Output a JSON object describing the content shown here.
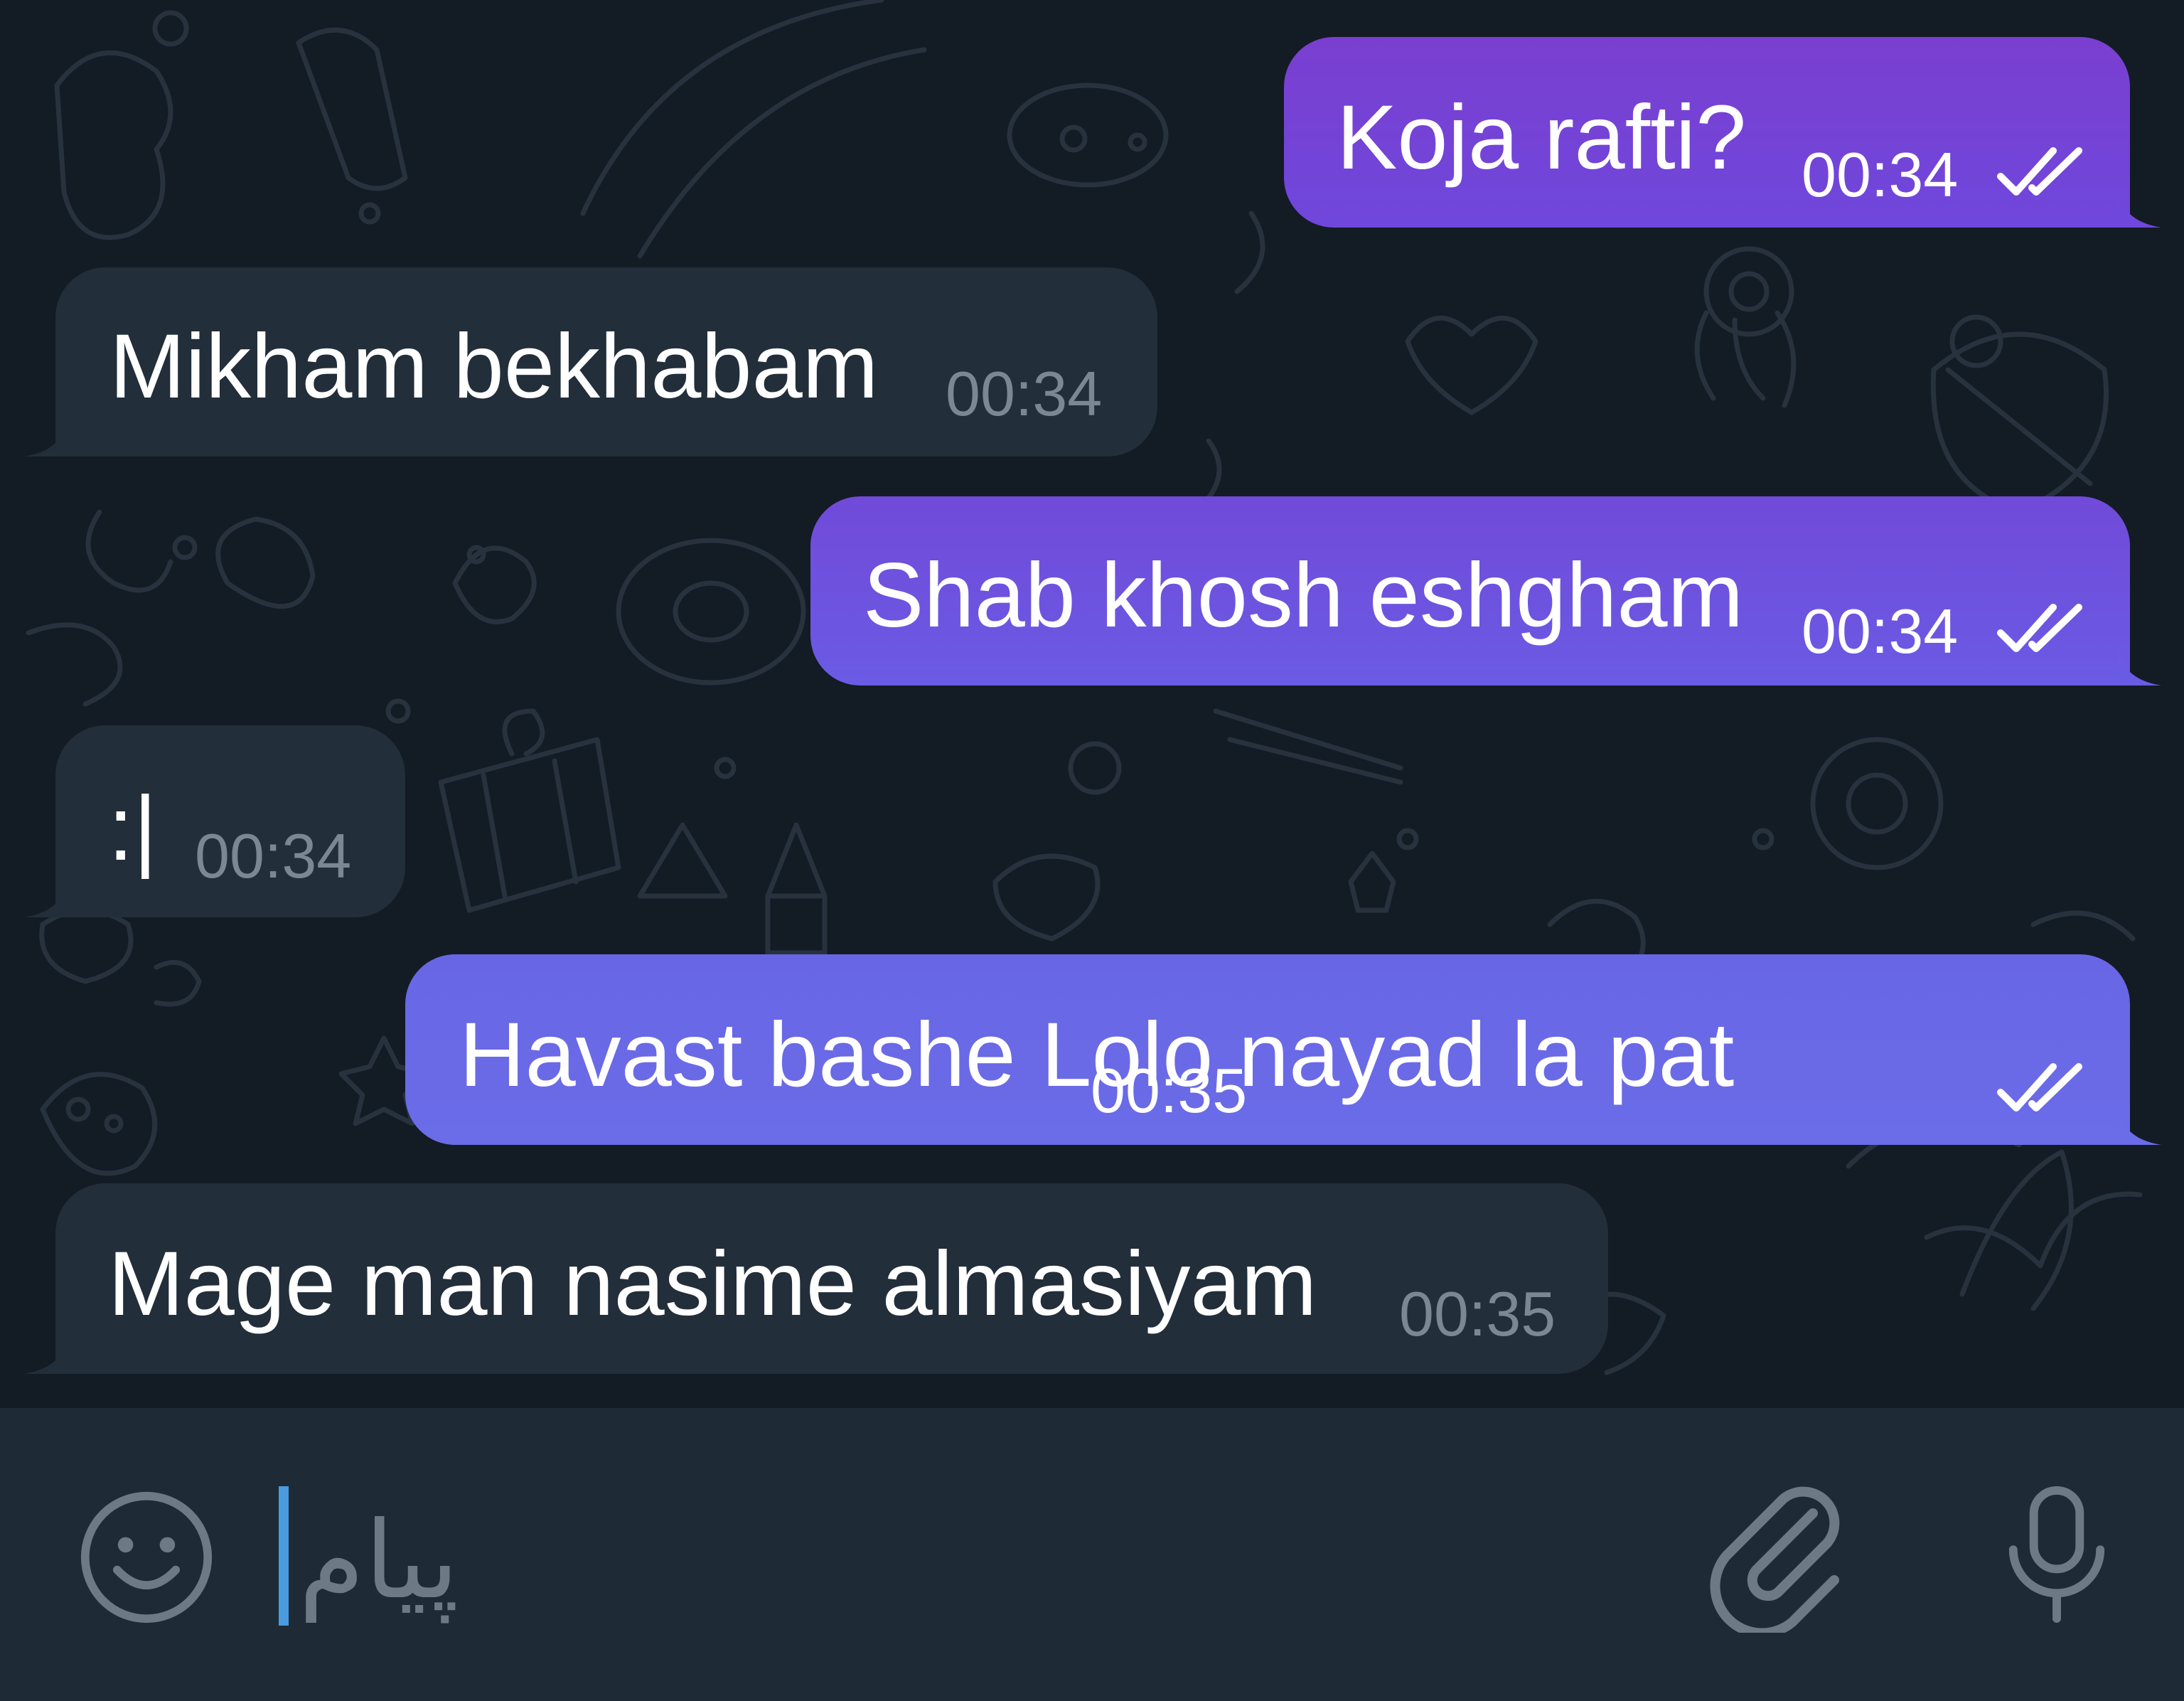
{
  "colors": {
    "outgoing_top": "#7b3fd1",
    "outgoing_bottom": "#6b6ce8",
    "incoming": "#222e3a",
    "background": "#131b24",
    "input_bar": "#1e2a36",
    "caret": "#4a9be0"
  },
  "messages": [
    {
      "direction": "out",
      "text": "Koja rafti?",
      "time": "00:34",
      "status": "read-double-check-icon"
    },
    {
      "direction": "in",
      "text": "Mikham bekhabam",
      "time": "00:34"
    },
    {
      "direction": "out",
      "text": "Shab khosh eshgham",
      "time": "00:34",
      "status": "read-double-check-icon"
    },
    {
      "direction": "in",
      "text": ":|",
      "time": "00:34"
    },
    {
      "direction": "out",
      "text": "Havast bashe Lolo nayad la pat",
      "time": "00:35",
      "status": "read-double-check-icon"
    },
    {
      "direction": "in",
      "text": "Mage man nasime almasiyam",
      "time": "00:35"
    }
  ],
  "composer": {
    "placeholder": "پیام",
    "emoji_icon": "smiley-face-icon",
    "attach_icon": "paperclip-icon",
    "mic_icon": "microphone-icon"
  }
}
